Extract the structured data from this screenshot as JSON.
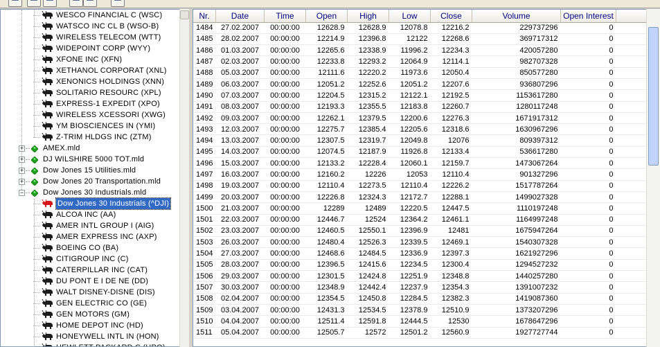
{
  "toolbar": {
    "buttons": [
      "new-icon",
      "open-icon",
      "save-icon",
      "edit-icon",
      "print-icon",
      "delete-icon"
    ]
  },
  "tree": {
    "top_stocks": [
      "WESCO FINANCIAL C (WSC)",
      "WATSCO INC CL B (WSO-B)",
      "WIRELESS TELECOM (WTT)",
      "WIDEPOINT CORP (WYY)",
      "XFONE INC (XFN)",
      "XETHANOL CORPORAT (XNL)",
      "XENONICS HOLDINGS (XNN)",
      "SOLITARIO RESOURC (XPL)",
      "EXPRESS-1 EXPEDIT (XPO)",
      "WIRELESS XCESSORI (XWG)",
      "YM BIOSCIENCES IN (YMI)",
      "Z-TRIM HLDGS INC (ZTM)"
    ],
    "databases": [
      {
        "label": "AMEX.mld",
        "expander": "+"
      },
      {
        "label": "DJ WILSHIRE 5000 TOT.mld",
        "expander": "+"
      },
      {
        "label": "Dow Jones 15 Utilities.mld",
        "expander": "+"
      },
      {
        "label": "Dow Jones 20 Transportation.mld",
        "expander": "+"
      },
      {
        "label": "Dow Jones 30 Industrials.mld",
        "expander": "−"
      }
    ],
    "selected": "Dow Jones 30 Industrials (^DJI)",
    "dji_stocks": [
      "ALCOA INC (AA)",
      "AMER INTL GROUP I (AIG)",
      "AMER EXPRESS INC (AXP)",
      "BOEING CO (BA)",
      "CITIGROUP INC (C)",
      "CATERPILLAR INC (CAT)",
      "DU PONT E I DE NE (DD)",
      "WALT DISNEY-DISNE (DIS)",
      "GEN ELECTRIC CO (GE)",
      "GEN MOTORS (GM)",
      "HOME DEPOT INC (HD)",
      "HONEYWELL INTL IN (HON)",
      "HEWLETT PACKARD C (HPQ)"
    ]
  },
  "grid": {
    "columns": [
      "Nr.",
      "Date",
      "Time",
      "Open",
      "High",
      "Low",
      "Close",
      "Volume",
      "Open Interest"
    ],
    "rows": [
      [
        "1484",
        "27.02.2007",
        "00:00:00",
        "12628.9",
        "12628.9",
        "12078.8",
        "12216.2",
        "229737296",
        "0"
      ],
      [
        "1485",
        "28.02.2007",
        "00:00:00",
        "12214.9",
        "12396.8",
        "12122",
        "12268.6",
        "369717312",
        "0"
      ],
      [
        "1486",
        "01.03.2007",
        "00:00:00",
        "12265.6",
        "12338.9",
        "11996.2",
        "12234.3",
        "420057280",
        "0"
      ],
      [
        "1487",
        "02.03.2007",
        "00:00:00",
        "12233.8",
        "12293.2",
        "12064.9",
        "12114.1",
        "982707328",
        "0"
      ],
      [
        "1488",
        "05.03.2007",
        "00:00:00",
        "12111.6",
        "12220.2",
        "11973.6",
        "12050.4",
        "850577280",
        "0"
      ],
      [
        "1489",
        "06.03.2007",
        "00:00:00",
        "12051.2",
        "12252.6",
        "12051.2",
        "12207.6",
        "936807296",
        "0"
      ],
      [
        "1490",
        "07.03.2007",
        "00:00:00",
        "12204.5",
        "12315.2",
        "12122.1",
        "12192.5",
        "1153617280",
        "0"
      ],
      [
        "1491",
        "08.03.2007",
        "00:00:00",
        "12193.3",
        "12355.5",
        "12183.8",
        "12260.7",
        "1280117248",
        "0"
      ],
      [
        "1492",
        "09.03.2007",
        "00:00:00",
        "12262.1",
        "12379.5",
        "12200.6",
        "12276.3",
        "1671917312",
        "0"
      ],
      [
        "1493",
        "12.03.2007",
        "00:00:00",
        "12275.7",
        "12385.4",
        "12205.6",
        "12318.6",
        "1630967296",
        "0"
      ],
      [
        "1494",
        "13.03.2007",
        "00:00:00",
        "12307.5",
        "12319.7",
        "12049.8",
        "12076",
        "809397312",
        "0"
      ],
      [
        "1495",
        "14.03.2007",
        "00:00:00",
        "12074.5",
        "12187.9",
        "11926.8",
        "12133.4",
        "536617280",
        "0"
      ],
      [
        "1496",
        "15.03.2007",
        "00:00:00",
        "12133.2",
        "12228.4",
        "12060.1",
        "12159.7",
        "1473067264",
        "0"
      ],
      [
        "1497",
        "16.03.2007",
        "00:00:00",
        "12160.2",
        "12226",
        "12053",
        "12110.4",
        "901327296",
        "0"
      ],
      [
        "1498",
        "19.03.2007",
        "00:00:00",
        "12110.4",
        "12273.5",
        "12110.4",
        "12226.2",
        "1517787264",
        "0"
      ],
      [
        "1499",
        "20.03.2007",
        "00:00:00",
        "12226.8",
        "12324.3",
        "12172.7",
        "12288.1",
        "1499027328",
        "0"
      ],
      [
        "1500",
        "21.03.2007",
        "00:00:00",
        "12289",
        "12489",
        "12220.5",
        "12447.5",
        "1110197248",
        "0"
      ],
      [
        "1501",
        "22.03.2007",
        "00:00:00",
        "12446.7",
        "12524",
        "12364.2",
        "12461.1",
        "1164997248",
        "0"
      ],
      [
        "1502",
        "23.03.2007",
        "00:00:00",
        "12460.5",
        "12550.1",
        "12396.9",
        "12481",
        "1675947264",
        "0"
      ],
      [
        "1503",
        "26.03.2007",
        "00:00:00",
        "12480.4",
        "12526.3",
        "12339.5",
        "12469.1",
        "1540307328",
        "0"
      ],
      [
        "1504",
        "27.03.2007",
        "00:00:00",
        "12468.6",
        "12484.5",
        "12336.9",
        "12397.3",
        "1621927296",
        "0"
      ],
      [
        "1505",
        "28.03.2007",
        "00:00:00",
        "12396.5",
        "12415.6",
        "12234.5",
        "12300.4",
        "1294527232",
        "0"
      ],
      [
        "1506",
        "29.03.2007",
        "00:00:00",
        "12301.5",
        "12424.8",
        "12251.9",
        "12348.8",
        "1440257280",
        "0"
      ],
      [
        "1507",
        "30.03.2007",
        "00:00:00",
        "12348.9",
        "12442.4",
        "12237.9",
        "12354.3",
        "1391007232",
        "0"
      ],
      [
        "1508",
        "02.04.2007",
        "00:00:00",
        "12354.5",
        "12450.8",
        "12284.5",
        "12382.3",
        "1419087360",
        "0"
      ],
      [
        "1509",
        "03.04.2007",
        "00:00:00",
        "12431.3",
        "12534.5",
        "12378.9",
        "12510.9",
        "1373207296",
        "0"
      ],
      [
        "1510",
        "04.04.2007",
        "00:00:00",
        "12511.4",
        "12591.8",
        "12444.5",
        "12530",
        "1678647296",
        "0"
      ],
      [
        "1511",
        "05.04.2007",
        "00:00:00",
        "12505.7",
        "12572",
        "12501.2",
        "12560.9",
        "1927727744",
        "0"
      ]
    ]
  }
}
